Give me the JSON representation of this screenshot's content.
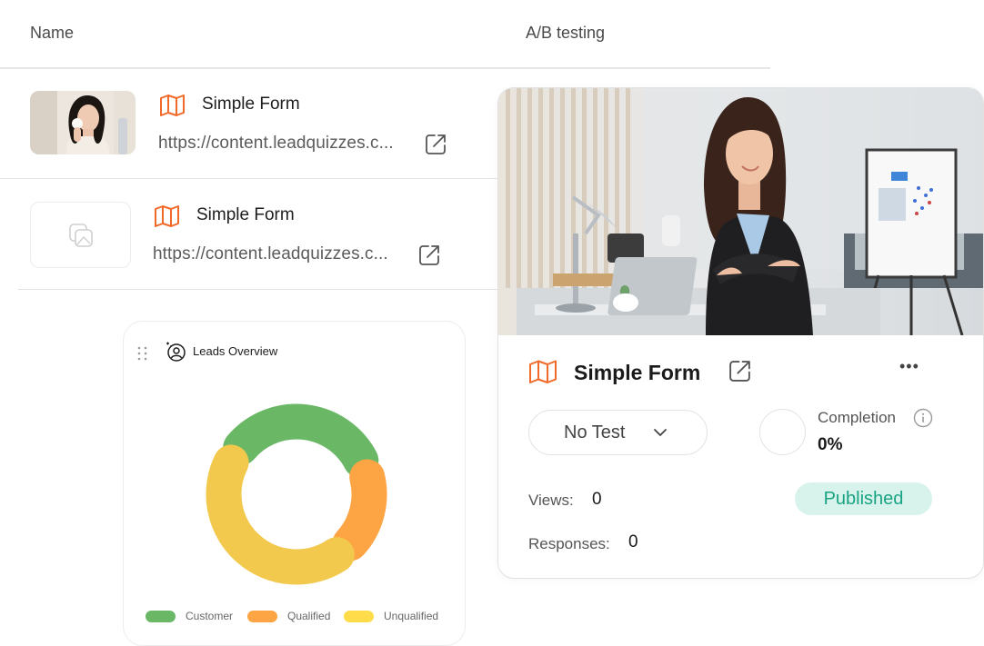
{
  "table": {
    "headers": {
      "name": "Name",
      "ab_testing": "A/B testing"
    },
    "rows": [
      {
        "title": "Simple Form",
        "url": "https://content.leadquizzes.c...",
        "thumbnail": "woman-skincare-photo"
      },
      {
        "title": "Simple Form",
        "url": "https://content.leadquizzes.c...",
        "thumbnail": "placeholder-image-icon"
      }
    ]
  },
  "leads": {
    "title": "Leads Overview",
    "chart_data": {
      "type": "pie",
      "title": "Leads Overview",
      "categories": [
        "Customer",
        "Qualified",
        "Unqualified"
      ],
      "values": [
        30,
        15,
        40
      ],
      "colors": [
        "#6ab866",
        "#fda544",
        "#f2c94c"
      ],
      "legend_colors": [
        "#6ab866",
        "#fda544",
        "#ffdd4a"
      ],
      "legend": "bottom"
    }
  },
  "card": {
    "title": "Simple Form",
    "ab_select": "No Test",
    "completion_label": "Completion",
    "completion_value": "0%",
    "completion_fraction": 0,
    "views_label": "Views:",
    "views_value": "0",
    "responses_label": "Responses:",
    "responses_value": "0",
    "status": "Published",
    "more": "•••"
  },
  "colors": {
    "accent_orange": "#f26a2a",
    "published_bg": "#d8f3ec",
    "published_text": "#19a383"
  }
}
